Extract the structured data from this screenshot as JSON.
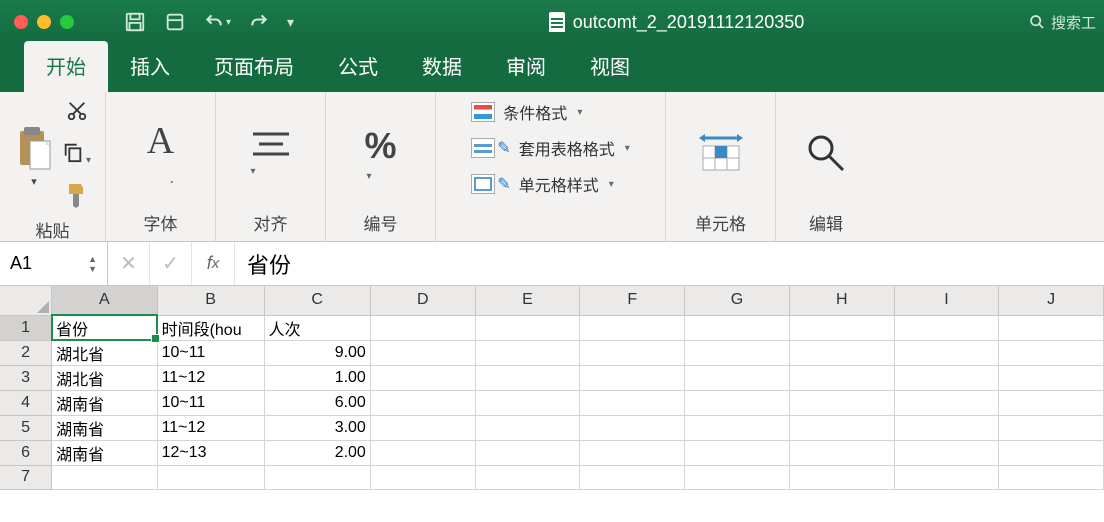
{
  "title_bar": {
    "file_name": "outcomt_2_20191112120350",
    "search_placeholder": "搜索工"
  },
  "tabs": [
    "开始",
    "插入",
    "页面布局",
    "公式",
    "数据",
    "审阅",
    "视图"
  ],
  "active_tab": 0,
  "ribbon": {
    "paste_label": "粘贴",
    "font_label": "字体",
    "align_label": "对齐",
    "number_label": "编号",
    "cond_fmt": "条件格式",
    "table_fmt": "套用表格格式",
    "cell_style": "单元格样式",
    "cells_label": "单元格",
    "edit_label": "编辑"
  },
  "name_box": "A1",
  "formula_value": "省份",
  "columns": [
    "A",
    "B",
    "C",
    "D",
    "E",
    "F",
    "G",
    "H",
    "I",
    "J"
  ],
  "rows": [
    {
      "n": 1,
      "cells": [
        "省份",
        "时间段(hou",
        "人次",
        "",
        "",
        "",
        "",
        "",
        "",
        ""
      ]
    },
    {
      "n": 2,
      "cells": [
        "湖北省",
        "10~11",
        "9.00",
        "",
        "",
        "",
        "",
        "",
        "",
        ""
      ]
    },
    {
      "n": 3,
      "cells": [
        "湖北省",
        "11~12",
        "1.00",
        "",
        "",
        "",
        "",
        "",
        "",
        ""
      ]
    },
    {
      "n": 4,
      "cells": [
        "湖南省",
        "10~11",
        "6.00",
        "",
        "",
        "",
        "",
        "",
        "",
        ""
      ]
    },
    {
      "n": 5,
      "cells": [
        "湖南省",
        "11~12",
        "3.00",
        "",
        "",
        "",
        "",
        "",
        "",
        ""
      ]
    },
    {
      "n": 6,
      "cells": [
        "湖南省",
        "12~13",
        "2.00",
        "",
        "",
        "",
        "",
        "",
        "",
        ""
      ]
    },
    {
      "n": 7,
      "cells": [
        "",
        "",
        "",
        "",
        "",
        "",
        "",
        "",
        "",
        ""
      ]
    }
  ],
  "selected": {
    "row": 1,
    "col": 0
  },
  "chart_data": {
    "type": "table",
    "title": "省份时间段人次",
    "columns": [
      "省份",
      "时间段(hour)",
      "人次"
    ],
    "rows": [
      [
        "湖北省",
        "10~11",
        9.0
      ],
      [
        "湖北省",
        "11~12",
        1.0
      ],
      [
        "湖南省",
        "10~11",
        6.0
      ],
      [
        "湖南省",
        "11~12",
        3.0
      ],
      [
        "湖南省",
        "12~13",
        2.0
      ]
    ]
  }
}
